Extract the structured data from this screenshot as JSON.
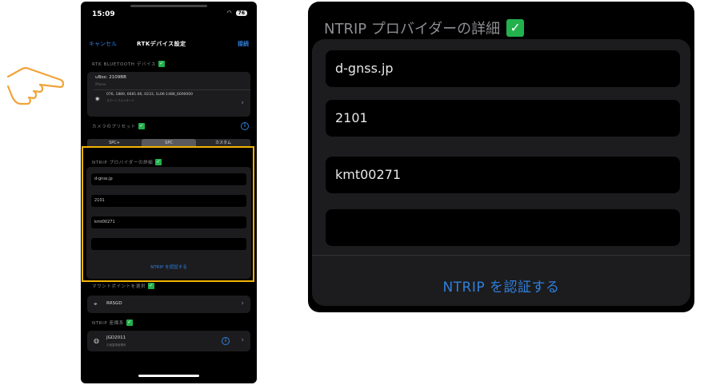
{
  "status": {
    "time": "15:09",
    "battery": "76"
  },
  "nav": {
    "cancel": "キャンセル",
    "title": "RTKデバイス設定",
    "done": "接続"
  },
  "sections": {
    "bluetooth": "RTK BLUETOOTH デバイス",
    "preset": "カメラのプリセット",
    "ntrip": "NTRIP プロバイダーの詳細",
    "mount": "マウントポイントを選択",
    "datum": "NTRIP 座標系"
  },
  "device": {
    "name": "uBox: 2109BB",
    "sub": "iPhone",
    "info": "076, 1889, 6681.66, 0233, 1L06-1488_6000000",
    "info2": "スマートフォンモード"
  },
  "preset_options": [
    "SPC+",
    "SPC",
    "カスタム"
  ],
  "preset_selected": 1,
  "ntrip_fields": [
    "d-gnss.jp",
    "2101",
    "kmt00271",
    ""
  ],
  "ntrip_button": "NTRIP を認証する",
  "mount": {
    "value": "RRSGD"
  },
  "datum": {
    "value": "JGD2011",
    "sub": "平面直角座標系"
  },
  "zoom": {
    "title": "NTRIP プロバイダーの詳細",
    "fields": [
      "d-gnss.jp",
      "2101",
      "kmt00271",
      ""
    ],
    "button": "NTRIP を認証する"
  },
  "colors": {
    "accent": "#2f7fdb",
    "highlight": "#f5b300",
    "check": "#22b14c"
  },
  "icons": {
    "hand": "pointing-hand-icon",
    "check": "checkmark-icon"
  }
}
